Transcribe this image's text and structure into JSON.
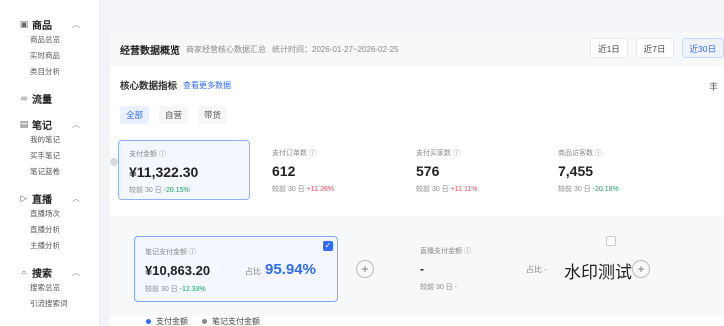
{
  "sidebar": {
    "sections": [
      {
        "icon": "goods-icon",
        "title": "商品",
        "items": [
          "商品总览",
          "实时商品",
          "类目分析"
        ]
      },
      {
        "icon": "traffic-icon",
        "title": "流量",
        "items": []
      },
      {
        "icon": "notes-icon",
        "title": "笔记",
        "items": [
          "我的笔记",
          "买手笔记",
          "笔记蓝卷"
        ]
      },
      {
        "icon": "live-icon",
        "title": "直播",
        "items": [
          "直播场次",
          "直播分析",
          "主播分析"
        ]
      },
      {
        "icon": "search-icon",
        "title": "搜索",
        "items": [
          "搜索总览",
          "引流搜索词"
        ]
      }
    ]
  },
  "header": {
    "title": "经营数据概览",
    "desc": "商家经营核心数据汇总",
    "period": "统计时间：2026-01-27~2026-02-25",
    "ranges": [
      "近1日",
      "近7日",
      "近30日"
    ],
    "active_range": "近30日"
  },
  "core": {
    "title": "核心数据指标",
    "link": "查看更多数据",
    "more": "丰",
    "tabs": [
      "全部",
      "自营",
      "带货"
    ]
  },
  "metrics": [
    {
      "label": "支付金额 ⓘ",
      "value": "¥11,322.30",
      "cmp_prefix": "较前 30 日",
      "cmp": "-20.15%",
      "trend": "dn"
    },
    {
      "label": "支付订单数 ⓘ",
      "value": "612",
      "cmp_prefix": "较前 30 日",
      "cmp": "+11.26%",
      "trend": "up"
    },
    {
      "label": "支付买家数 ⓘ",
      "value": "576",
      "cmp_prefix": "较前 30 日",
      "cmp": "+11.11%",
      "trend": "up"
    },
    {
      "label": "商品访客数 ⓘ",
      "value": "7,455",
      "cmp_prefix": "较前 30 日",
      "cmp": "-20.18%",
      "trend": "dn"
    }
  ],
  "breakdown": {
    "card1": {
      "label": "笔记支付金额 ⓘ",
      "value": "¥10,863.20",
      "share_label": "占比",
      "share": "95.94%",
      "cmp_prefix": "较前 30 日",
      "cmp": "-12.33%"
    },
    "card2": {
      "label": "直播支付金额 ⓘ",
      "value": "-",
      "share_label": "占比 -",
      "cmp_prefix": "较前 30 日",
      "cmp": "-"
    },
    "watermark": "水印测试"
  },
  "legend": [
    {
      "label": "支付金额",
      "color": "#2f6bff"
    },
    {
      "label": "笔记支付金额",
      "color": "#888888"
    }
  ]
}
